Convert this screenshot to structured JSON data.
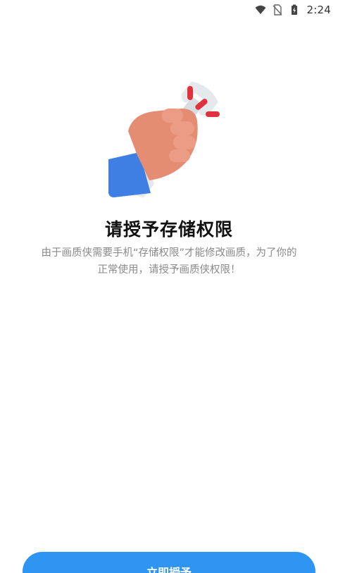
{
  "status_bar": {
    "time": "2:24",
    "icons": [
      "wifi-icon",
      "no-sim-icon",
      "battery-charging-icon"
    ]
  },
  "permission": {
    "illustration": "hand-holding-wrench-icon",
    "title": "请授予存储权限",
    "description_line1": "由于画质侠需要手机“存储权限”才能修改画质，为了你的",
    "description_line2": "正常使用，请授予画质侠权限！"
  },
  "actions": {
    "grant_label": "立即授予"
  },
  "colors": {
    "accent": "#2f95f3",
    "title": "#111111",
    "description": "#8a8a8a"
  }
}
